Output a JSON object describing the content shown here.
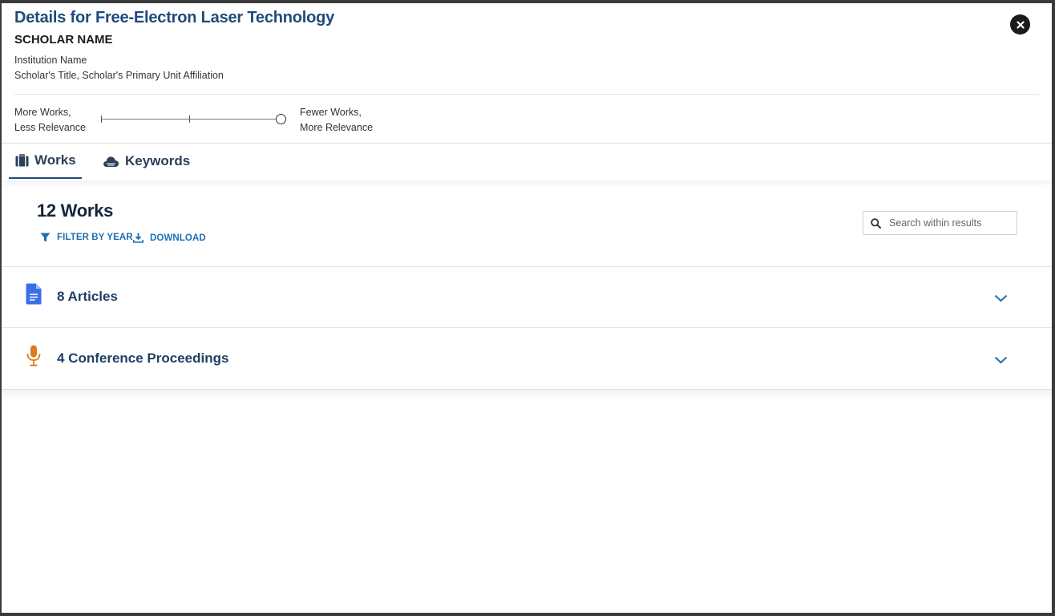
{
  "modal": {
    "title": "Details for Free-Electron Laser Technology",
    "close_icon": "close-icon"
  },
  "scholar": {
    "name": "SCHOLAR NAME",
    "institution": "Institution Name",
    "affiliation": "Scholar's Title, Scholar's Primary Unit Affiliation"
  },
  "relevance_slider": {
    "left_line1": "More Works,",
    "left_line2": "Less Relevance",
    "right_line1": "Fewer Works,",
    "right_line2": "More Relevance",
    "position": "max"
  },
  "tabs": [
    {
      "label": "Works",
      "icon": "briefcase-icon",
      "active": true
    },
    {
      "label": "Keywords",
      "icon": "cloud-icon",
      "active": false
    }
  ],
  "works": {
    "count_label": "12 Works",
    "filter_label": "FILTER BY YEAR",
    "download_label": "DOWNLOAD",
    "search_placeholder": "Search within results"
  },
  "groups": [
    {
      "label": "8 Articles",
      "icon": "document-icon",
      "icon_color": "#3b6fe8"
    },
    {
      "label": "4 Conference Proceedings",
      "icon": "microphone-icon",
      "icon_color": "#e07a1f"
    }
  ],
  "colors": {
    "title": "#1f4b7a",
    "link": "#1f6fb2"
  }
}
